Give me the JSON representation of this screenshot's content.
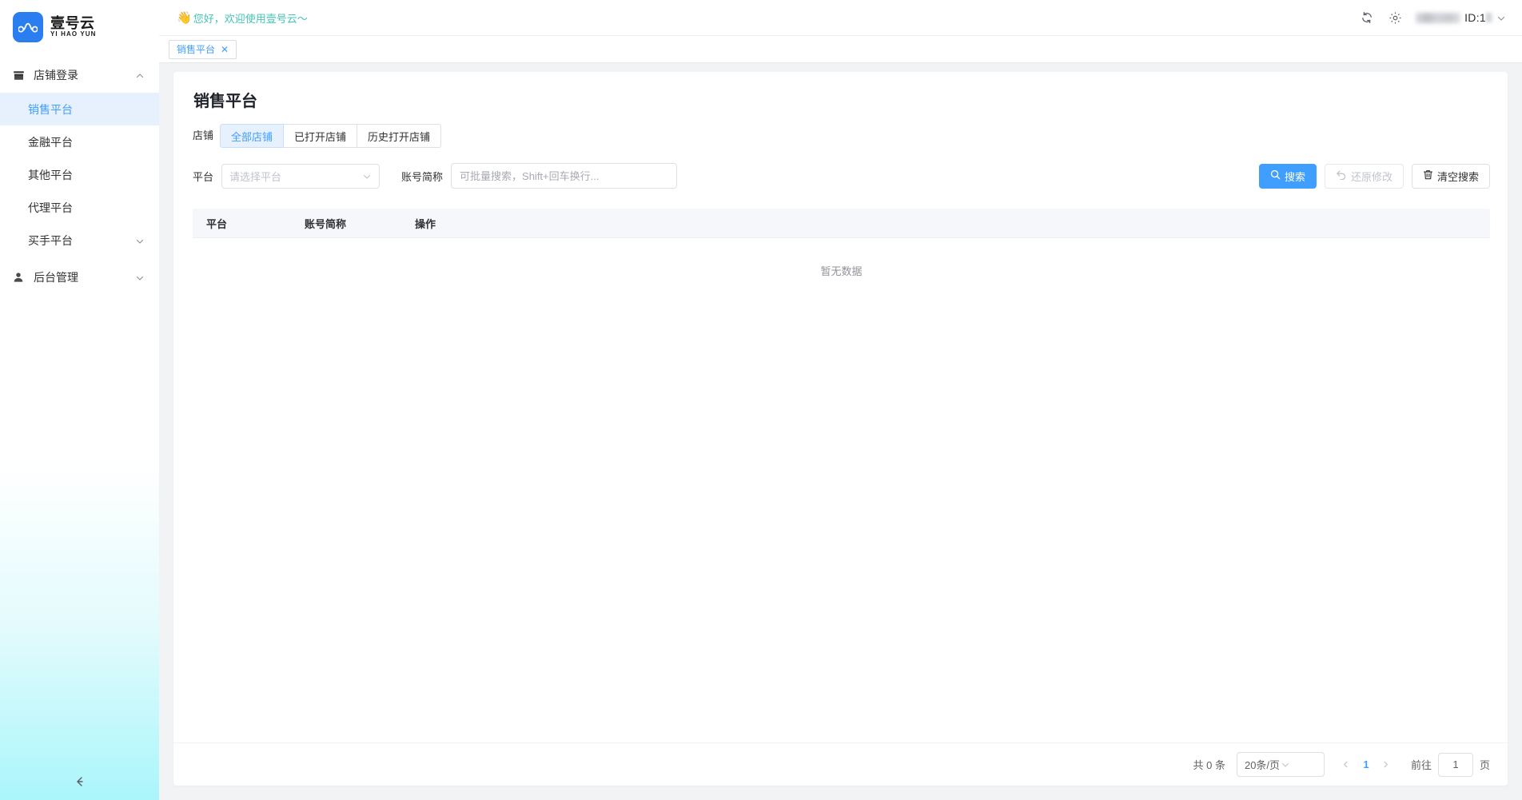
{
  "brand": {
    "name_cn": "壹号云",
    "name_en": "YI HAO YUN",
    "logo_icon": "wave-dots-logo",
    "accent": "#2b7ef0"
  },
  "topbar": {
    "greeting_emoji": "👋",
    "greeting": "您好，欢迎使用壹号云～",
    "greeting_color": "#44c5b5",
    "refresh_icon": "refresh-icon",
    "settings_icon": "gear-icon",
    "user_id_label": "ID:1",
    "user_chevron_icon": "chevron-down-icon"
  },
  "page_tabs": [
    {
      "label": "销售平台",
      "close_icon": "close-icon",
      "active": true
    }
  ],
  "sidebar": {
    "groups": [
      {
        "label": "店铺登录",
        "icon": "shop-icon",
        "expanded": true,
        "chevron": "chevron-up-icon",
        "items": [
          {
            "label": "销售平台",
            "active": true,
            "chevron": ""
          },
          {
            "label": "金融平台",
            "active": false,
            "chevron": ""
          },
          {
            "label": "其他平台",
            "active": false,
            "chevron": ""
          },
          {
            "label": "代理平台",
            "active": false,
            "chevron": ""
          },
          {
            "label": "买手平台",
            "active": false,
            "chevron": "chevron-down-icon"
          }
        ]
      },
      {
        "label": "后台管理",
        "icon": "user-icon",
        "expanded": false,
        "chevron": "chevron-down-icon",
        "items": []
      }
    ],
    "collapse_icon": "arrow-left-icon"
  },
  "main": {
    "title": "销售平台",
    "tabs_label": "店铺",
    "tabs": [
      {
        "label": "全部店铺",
        "active": true
      },
      {
        "label": "已打开店铺",
        "active": false
      },
      {
        "label": "历史打开店铺",
        "active": false
      }
    ],
    "filters": {
      "platform_label": "平台",
      "platform_placeholder": "请选择平台",
      "platform_value": "",
      "platform_chevron": "chevron-down-icon",
      "account_label": "账号简称",
      "account_placeholder": "可批量搜索，Shift+回车换行...",
      "account_value": ""
    },
    "buttons": {
      "search": {
        "label": "搜索",
        "icon": "search-icon",
        "state": "primary"
      },
      "restore": {
        "label": "还原修改",
        "icon": "undo-icon",
        "state": "disabled"
      },
      "clear": {
        "label": "清空搜索",
        "icon": "trash-icon",
        "state": "default"
      }
    },
    "table": {
      "columns": [
        "平台",
        "账号简称",
        "操作"
      ],
      "rows": [],
      "empty_text": "暂无数据"
    },
    "pagination": {
      "total_text": "共 0 条",
      "page_size": "20条/页",
      "page_size_chevron": "chevron-down-icon",
      "prev_icon": "chevron-left-icon",
      "next_icon": "chevron-right-icon",
      "current_page": "1",
      "jump_label": "前往",
      "jump_value": "1",
      "jump_suffix": "页"
    }
  }
}
